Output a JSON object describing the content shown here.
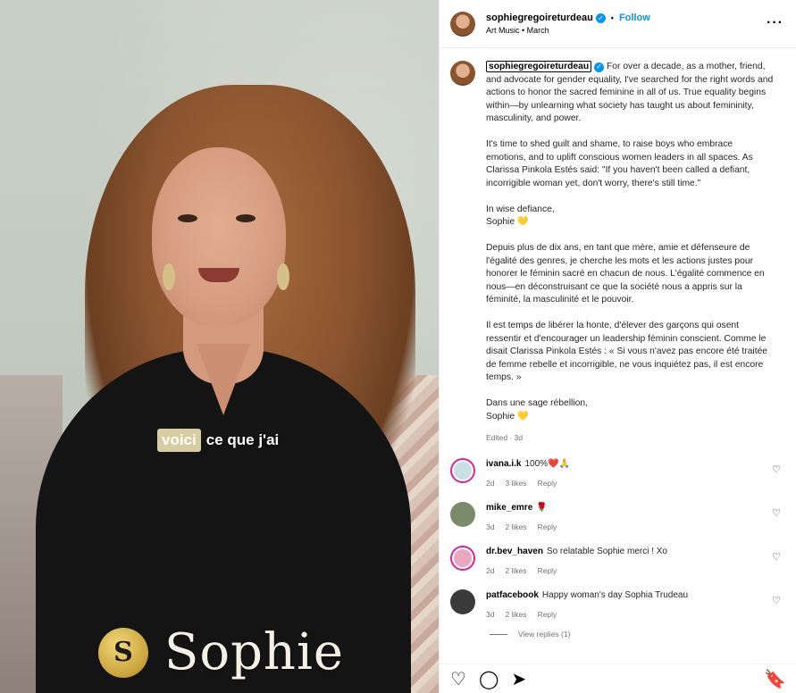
{
  "video": {
    "caption_highlight": "voici",
    "caption_rest": "ce que j'ai",
    "brand_logo_glyph": "S",
    "brand_name": "Sophie"
  },
  "post_header": {
    "username": "sophiegregoireturdeau",
    "follow_label": "Follow",
    "subtitle": "Art Music • March",
    "more_icon": "more-horizontal-icon"
  },
  "caption": {
    "username": "sophiegregoireturdeau",
    "paragraphs": [
      "For over a decade, as a mother, friend, and advocate for gender equality, I've searched for the right words and actions to honor the sacred feminine in all of us. True equality begins within—by unlearning what society has taught us about femininity, masculinity, and power.",
      "It's time to shed guilt and shame, to raise boys who embrace emotions, and to uplift conscious women leaders in all spaces. As Clarissa Pinkola Estés said: \"If you haven't been called a defiant, incorrigible woman yet, don't worry, there's still time.\"",
      "In wise defiance,\nSophie 💛",
      "Depuis plus de dix ans, en tant que mère, amie et défenseure de l'égalité des genres, je cherche les mots et les actions justes pour honorer le féminin sacré en chacun de nous. L'égalité commence en nous—en déconstruisant ce que la société nous a appris sur la féminité, la masculinité et le pouvoir.",
      "Il est temps de libérer la honte, d'élever des garçons qui osent ressentir et d'encourager un leadership féminin conscient. Comme le disait Clarissa Pinkola Estés : « Si vous n'avez pas encore été traitée de femme rebelle et incorrigible, ne vous inquiétez pas, il est encore temps. »",
      "Dans une sage rébellion,\nSophie 💛"
    ],
    "edited": "Edited · 3d"
  },
  "comments": [
    {
      "user": "ivana.i.k",
      "text": "100%❤️🙏",
      "age": "2d",
      "likes": "3 likes",
      "reply": "Reply",
      "avatar_color": "#c9dfe8",
      "ring": true
    },
    {
      "user": "mike_emre",
      "text": "🌹",
      "age": "3d",
      "likes": "2 likes",
      "reply": "Reply",
      "avatar_color": "#7a8a6a",
      "ring": false
    },
    {
      "user": "dr.bev_haven",
      "text": "So relatable Sophie merci ! Xo",
      "age": "2d",
      "likes": "2 likes",
      "reply": "Reply",
      "avatar_color": "#e8a8c0",
      "ring": true
    },
    {
      "user": "patfacebook",
      "text": "Happy woman's day Sophia Trudeau",
      "age": "3d",
      "likes": "2 likes",
      "reply": "Reply",
      "avatar_color": "#3a3a3a",
      "ring": false
    }
  ],
  "view_replies": "View replies (1)",
  "actions": {
    "like_icon": "heart-icon",
    "comment_icon": "comment-icon",
    "share_icon": "send-icon",
    "save_icon": "bookmark-icon"
  },
  "colors": {
    "accent": "#0095f6",
    "story_ring": "#d6249f"
  }
}
